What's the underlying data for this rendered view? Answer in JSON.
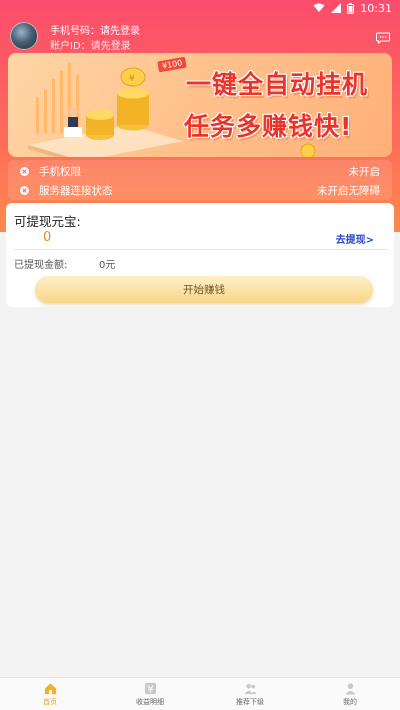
{
  "status_bar": {
    "time": "10:31"
  },
  "header": {
    "phone_line": "手机号码：请先登录",
    "account_line": "账户ID：请先登录"
  },
  "banner": {
    "line1": "一键全自动挂机",
    "line2": "任务多赚钱快!",
    "tag": "¥100"
  },
  "status_rows": [
    {
      "label": "手机权限",
      "value": "未开启"
    },
    {
      "label": "服务器连接状态",
      "value": "未开启无障碍"
    }
  ],
  "withdraw": {
    "title": "可提现元宝:",
    "amount": "0",
    "link": "去提现>",
    "withdrawn_label": "已提现金额:",
    "withdrawn_value": "0元",
    "start_button": "开始赚钱"
  },
  "nav": [
    {
      "label": "首页",
      "icon": "home-icon",
      "active": true
    },
    {
      "label": "收益明细",
      "icon": "income-icon",
      "active": false
    },
    {
      "label": "推荐下级",
      "icon": "referral-icon",
      "active": false
    },
    {
      "label": "我的",
      "icon": "profile-icon",
      "active": false
    }
  ],
  "colors": {
    "header_gradient_top": "#fb4c6c",
    "header_gradient_bottom": "#fd8a4c",
    "amount": "#f08a2a",
    "link": "#2b49c6",
    "nav_active": "#e8a21c"
  }
}
